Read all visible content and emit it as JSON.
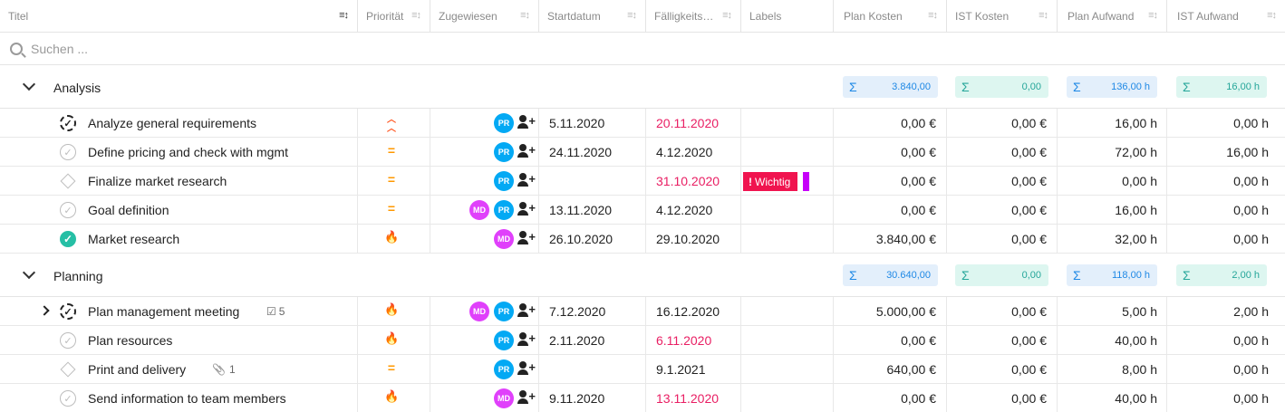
{
  "header": {
    "columns": [
      {
        "label": "Titel"
      },
      {
        "label": "Priorität"
      },
      {
        "label": "Zugewiesen"
      },
      {
        "label": "Startdatum"
      },
      {
        "label": "Fälligkeits…"
      },
      {
        "label": "Labels"
      },
      {
        "label": "Plan Kosten"
      },
      {
        "label": "IST Kosten"
      },
      {
        "label": "Plan Aufwand"
      },
      {
        "label": "IST Aufwand"
      }
    ]
  },
  "search": {
    "placeholder": "Suchen ..."
  },
  "groups": [
    {
      "name": "Analysis",
      "sums": {
        "plan_kosten": "3.840,00",
        "ist_kosten": "0,00",
        "plan_aufwand": "136,00 h",
        "ist_aufwand": "16,00 h"
      },
      "rows": [
        {
          "title": "Analyze general requirements",
          "status": "in-progress",
          "priority": "high",
          "assignees": [
            "PR"
          ],
          "start": "5.11.2020",
          "due": "20.11.2020",
          "due_overdue": true,
          "label": "",
          "plan_kosten": "0,00 €",
          "ist_kosten": "0,00 €",
          "plan_aufwand": "16,00 h",
          "ist_aufwand": "0,00 h"
        },
        {
          "title": "Define pricing and check with mgmt",
          "status": "open",
          "priority": "medium",
          "assignees": [
            "PR"
          ],
          "start": "24.11.2020",
          "due": "4.12.2020",
          "due_overdue": false,
          "label": "",
          "plan_kosten": "0,00 €",
          "ist_kosten": "0,00 €",
          "plan_aufwand": "72,00 h",
          "ist_aufwand": "16,00 h"
        },
        {
          "title": "Finalize market research",
          "status": "milestone",
          "priority": "medium",
          "assignees": [
            "PR"
          ],
          "start": "",
          "due": "31.10.2020",
          "due_overdue": true,
          "label": "Wichtig",
          "plan_kosten": "0,00 €",
          "ist_kosten": "0,00 €",
          "plan_aufwand": "0,00 h",
          "ist_aufwand": "0,00 h"
        },
        {
          "title": "Goal definition",
          "status": "open",
          "priority": "medium",
          "assignees": [
            "MD",
            "PR"
          ],
          "start": "13.11.2020",
          "due": "4.12.2020",
          "due_overdue": false,
          "label": "",
          "plan_kosten": "0,00 €",
          "ist_kosten": "0,00 €",
          "plan_aufwand": "16,00 h",
          "ist_aufwand": "0,00 h"
        },
        {
          "title": "Market research",
          "status": "done",
          "priority": "urgent",
          "assignees": [
            "MD"
          ],
          "start": "26.10.2020",
          "due": "29.10.2020",
          "due_overdue": false,
          "label": "",
          "plan_kosten": "3.840,00 €",
          "ist_kosten": "0,00 €",
          "plan_aufwand": "32,00 h",
          "ist_aufwand": "0,00 h"
        }
      ]
    },
    {
      "name": "Planning",
      "sums": {
        "plan_kosten": "30.640,00",
        "ist_kosten": "0,00",
        "plan_aufwand": "118,00 h",
        "ist_aufwand": "2,00 h"
      },
      "rows": [
        {
          "title": "Plan management meeting",
          "status": "in-progress",
          "priority": "urgent",
          "assignees": [
            "MD",
            "PR"
          ],
          "start": "7.12.2020",
          "due": "16.12.2020",
          "due_overdue": false,
          "label": "",
          "subtasks": "5",
          "plan_kosten": "5.000,00 €",
          "ist_kosten": "0,00 €",
          "plan_aufwand": "5,00 h",
          "ist_aufwand": "2,00 h"
        },
        {
          "title": "Plan resources",
          "status": "open",
          "priority": "urgent",
          "assignees": [
            "PR"
          ],
          "start": "2.11.2020",
          "due": "6.11.2020",
          "due_overdue": true,
          "label": "",
          "plan_kosten": "0,00 €",
          "ist_kosten": "0,00 €",
          "plan_aufwand": "40,00 h",
          "ist_aufwand": "0,00 h"
        },
        {
          "title": "Print and delivery",
          "status": "milestone",
          "priority": "medium",
          "assignees": [
            "PR"
          ],
          "start": "",
          "due": "9.1.2021",
          "due_overdue": false,
          "label": "",
          "attachments": "1",
          "plan_kosten": "640,00 €",
          "ist_kosten": "0,00 €",
          "plan_aufwand": "8,00 h",
          "ist_aufwand": "0,00 h"
        },
        {
          "title": "Send information to team members",
          "status": "open",
          "priority": "urgent",
          "assignees": [
            "MD"
          ],
          "start": "9.11.2020",
          "due": "13.11.2020",
          "due_overdue": true,
          "label": "",
          "plan_kosten": "0,00 €",
          "ist_kosten": "0,00 €",
          "plan_aufwand": "40,00 h",
          "ist_aufwand": "0,00 h"
        }
      ]
    }
  ],
  "icons": {
    "sort": "sort-icon",
    "search": "search-icon",
    "add_user": "add-user-icon"
  },
  "colors": {
    "overdue": "#e91e63",
    "label_wichtig": "#f0144f",
    "avatar_pr": "#03a9f4",
    "avatar_md": "#e040fb",
    "done": "#26bfa5"
  }
}
